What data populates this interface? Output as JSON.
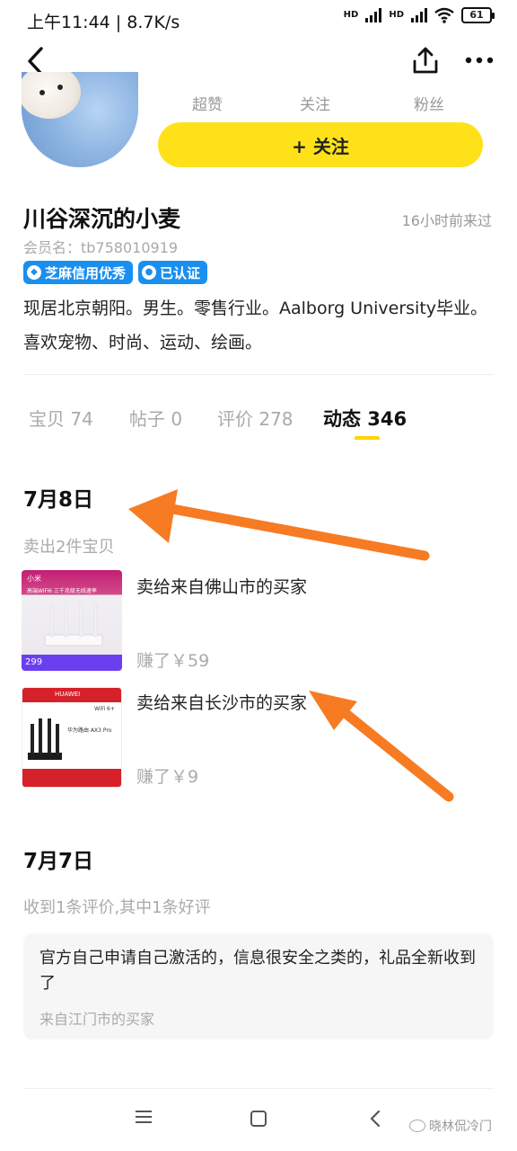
{
  "status_bar": {
    "time": "上午11:44 | 8.7K/s",
    "signal1": "HD",
    "signal2": "HD",
    "battery": "61"
  },
  "nav": {
    "back_icon": "chevron-left-icon",
    "share_icon": "share-upload-icon",
    "more_icon": "more-dots-icon"
  },
  "profile": {
    "stats": [
      "超赞",
      "关注",
      "粉丝"
    ],
    "follow_label": "+ 关注",
    "name": "川谷深沉的小麦",
    "last_seen": "16小时前来过",
    "member_id": "会员名：tb758010919",
    "badges": [
      "芝麻信用优秀",
      "已认证"
    ],
    "bio": "现居北京朝阳。男生。零售行业。Aalborg University毕业。喜欢宠物、时尚、运动、绘画。"
  },
  "tabs": [
    {
      "label": "宝贝 74",
      "active": false
    },
    {
      "label": "帖子 0",
      "active": false
    },
    {
      "label": "评价 278",
      "active": false
    },
    {
      "label": "动态 346",
      "active": true
    }
  ],
  "feed": {
    "day1": {
      "date": "7月8日",
      "summary": "卖出2件宝贝",
      "items": [
        {
          "title": "卖给来自佛山市的买家",
          "earned": "赚了￥59",
          "thumb_brand": "小米",
          "thumb_headline": "高端WiFi6 三千兆级无线速率",
          "thumb_price": "299"
        },
        {
          "title": "卖给来自长沙市的买家",
          "earned": "赚了￥9",
          "thumb_brand": "HUAWEI",
          "thumb_headline": "华为路由 AX3 Pro",
          "thumb_tag": "WiFi 6+"
        }
      ]
    },
    "day2": {
      "date": "7月7日",
      "summary": "收到1条评价,其中1条好评",
      "review_text": "官方自己申请自己激活的，信息很安全之类的，礼品全新收到了",
      "review_from": "来自江门市的买家"
    }
  },
  "annotation_color": "#f77b22",
  "accent_color": "#ffe11a",
  "watermark": "晓林侃冷门"
}
